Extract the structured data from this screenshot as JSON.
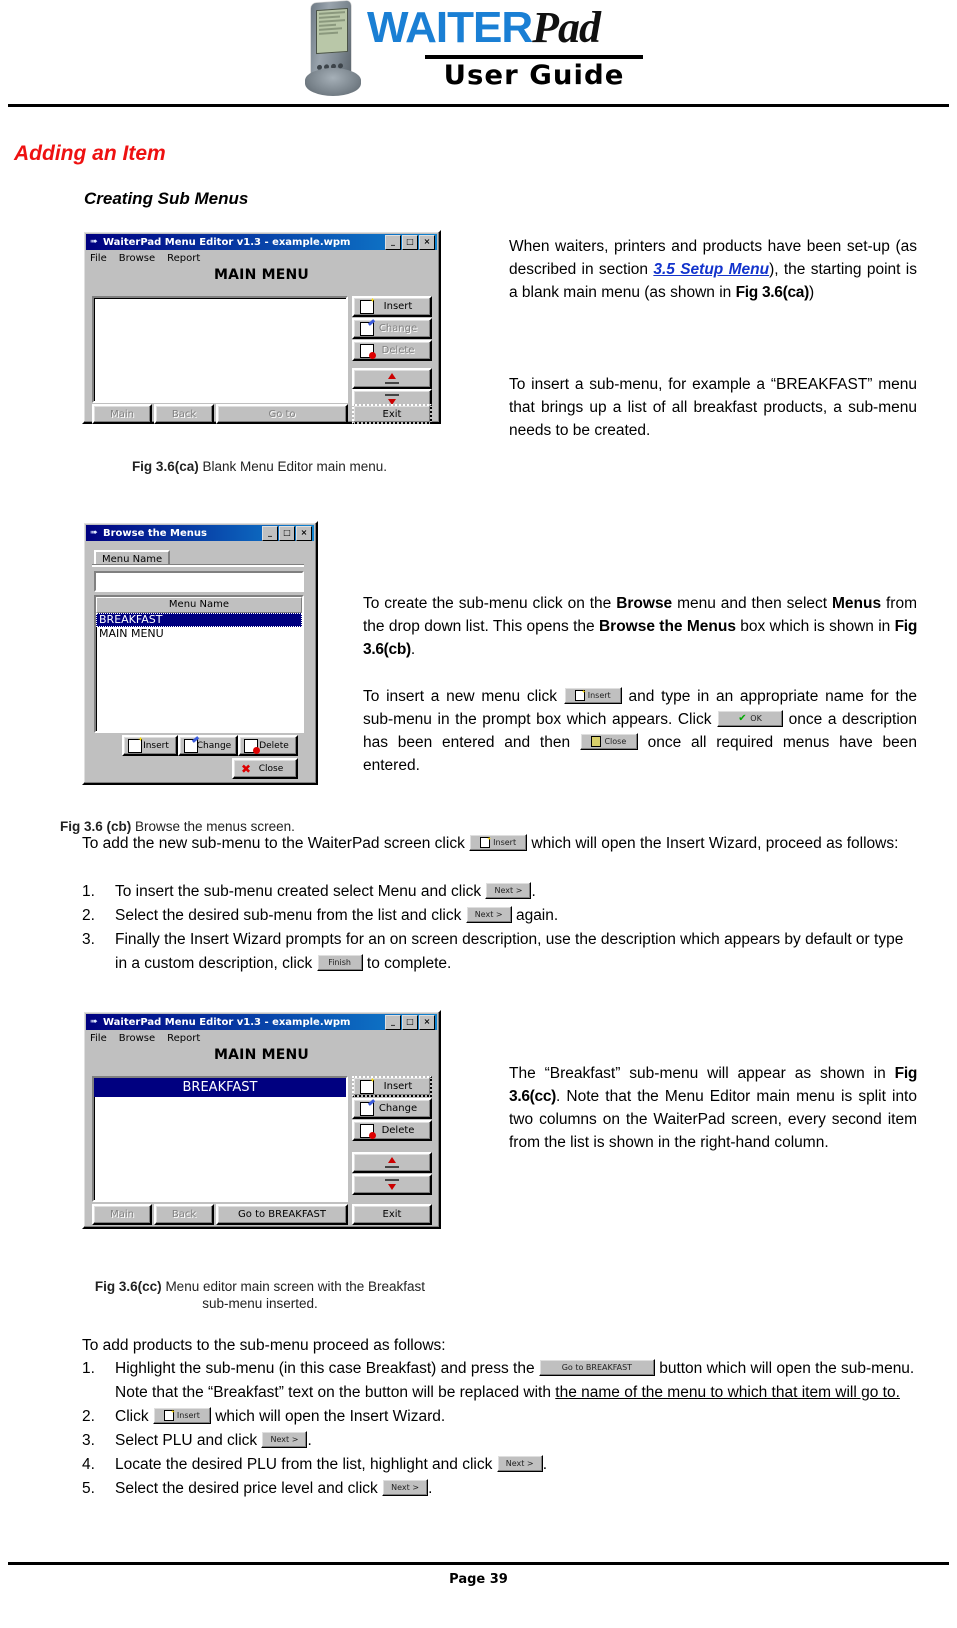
{
  "header": {
    "brand_primary": "WAITER",
    "brand_secondary": "Pad",
    "brand_subtitle": "User Guide",
    "device_icon": "pda-device-icon"
  },
  "headings": {
    "section_title": "Adding an Item",
    "sub_title": "Creating Sub Menus"
  },
  "figures": {
    "fig_ca": {
      "caption_label": "Fig 3.6(ca)",
      "caption_text": " Blank Menu Editor main menu.",
      "window": {
        "title": "WaiterPad Menu Editor v1.3 - example.wpm",
        "menus": [
          "File",
          "Browse",
          "Report"
        ],
        "screen_title": "MAIN MENU",
        "list_items": [],
        "buttons_right": [
          "Insert",
          "Change",
          "Delete"
        ],
        "buttons_bottom": [
          "Main",
          "Back",
          "Go to",
          "Exit"
        ],
        "titlebar_buttons": [
          "_",
          "□",
          "×"
        ]
      }
    },
    "fig_cb": {
      "caption_label": "Fig 3.6 (cb)",
      "caption_text": " Browse the menus screen.",
      "window": {
        "title": "Browse the Menus",
        "tab_label": "Menu Name",
        "search_value": "",
        "column_header": "Menu Name",
        "list_items": [
          "BREAKFAST",
          "MAIN MENU"
        ],
        "selected_index": 0,
        "buttons": [
          "Insert",
          "Change",
          "Delete"
        ],
        "close_button": "Close",
        "titlebar_buttons": [
          "_",
          "□",
          "×"
        ]
      }
    },
    "fig_cc": {
      "caption_label": "Fig 3.6(cc)",
      "caption_line1": " Menu editor main screen with the Breakfast",
      "caption_line2": "sub-menu inserted.",
      "window": {
        "title": "WaiterPad Menu Editor v1.3 - example.wpm",
        "menus": [
          "File",
          "Browse",
          "Report"
        ],
        "screen_title": "MAIN MENU",
        "list_items": [
          "BREAKFAST"
        ],
        "buttons_right": [
          "Insert",
          "Change",
          "Delete"
        ],
        "buttons_bottom": [
          "Main",
          "Back",
          "Go to BREAKFAST",
          "Exit"
        ],
        "titlebar_buttons": [
          "_",
          "□",
          "×"
        ]
      }
    }
  },
  "body": {
    "para1_a": "When waiters, printers and products have been set-up (as described in section ",
    "para1_link": "3.5 Setup Menu",
    "para1_b": "), the starting point is a blank main menu (as shown in ",
    "para1_ref": "Fig 3.6(ca)",
    "para1_c": ")",
    "para2": "To insert a sub-menu, for example a “BREAKFAST” menu that brings up a list of all breakfast products, a sub-menu needs to be created.",
    "para3_a": "To create the sub-menu click on the ",
    "para3_b1": "Browse",
    "para3_c": " menu and then select ",
    "para3_b2": "Menus",
    "para3_d": " from the drop down list. This opens the ",
    "para3_b3": "Browse the Menus",
    "para3_e": " box which is shown in ",
    "para3_ref": "Fig 3.6(cb)",
    "para3_f": ".",
    "para4_a": "To insert a new menu click ",
    "para4_b": " and type in an appropriate name for the sub-menu in the prompt box which appears. Click ",
    "para4_c": " once a description has been entered and then ",
    "para4_d": " once all required menus have been entered.",
    "para5_a": "To add the new sub-menu to the WaiterPad screen click ",
    "para5_b": " which will open the Insert Wizard, proceed as follows:",
    "list1": [
      {
        "num": "1.",
        "pre": "To insert the sub-menu created select Menu and click ",
        "btn": "Next >",
        "post": "."
      },
      {
        "num": "2.",
        "pre": "Select the desired sub-menu from the list and click ",
        "btn": "Next >",
        "post": " again."
      },
      {
        "num": "3.",
        "pre": "Finally the Insert Wizard prompts for an on screen description, use the description which appears by default or type in a custom description, click ",
        "btn": "Finish",
        "post": " to complete."
      }
    ],
    "para6_a": "The “Breakfast” sub-menu will appear as shown in ",
    "para6_ref": "Fig 3.6(cc)",
    "para6_b": ". Note that the Menu Editor main menu is split into two columns on the WaiterPad screen, every second item from the list is shown in the right-hand column.",
    "para7": "To add products to the sub-menu proceed as follows:",
    "list2": [
      {
        "num": "1.",
        "pre": "Highlight the sub-menu (in this case Breakfast) and press the ",
        "btn": "Go to BREAKFAST",
        "post": " button which will open the sub-menu. Note that the “Breakfast” text on the button will be replaced with ",
        "post_underline": "the name of the menu to which that item will go to."
      },
      {
        "num": "2.",
        "pre": "Click ",
        "btn": "Insert",
        "post": " which will open the Insert Wizard."
      },
      {
        "num": "3.",
        "pre": "Select PLU and click ",
        "btn": "Next >",
        "post": "."
      },
      {
        "num": "4.",
        "pre": "Locate the desired PLU from the list, highlight and click ",
        "btn": "Next >",
        "post": "."
      },
      {
        "num": "5.",
        "pre": "Select the desired price level and click ",
        "btn": "Next >",
        "post": "."
      }
    ]
  },
  "footer": {
    "page_label": "Page 39"
  },
  "colors": {
    "heading_red": "#ee1111",
    "link_blue": "#1233cc",
    "brand_blue": "#1a7fd4",
    "win_titlebar": "#000080",
    "win_face": "#c0c0c0"
  }
}
